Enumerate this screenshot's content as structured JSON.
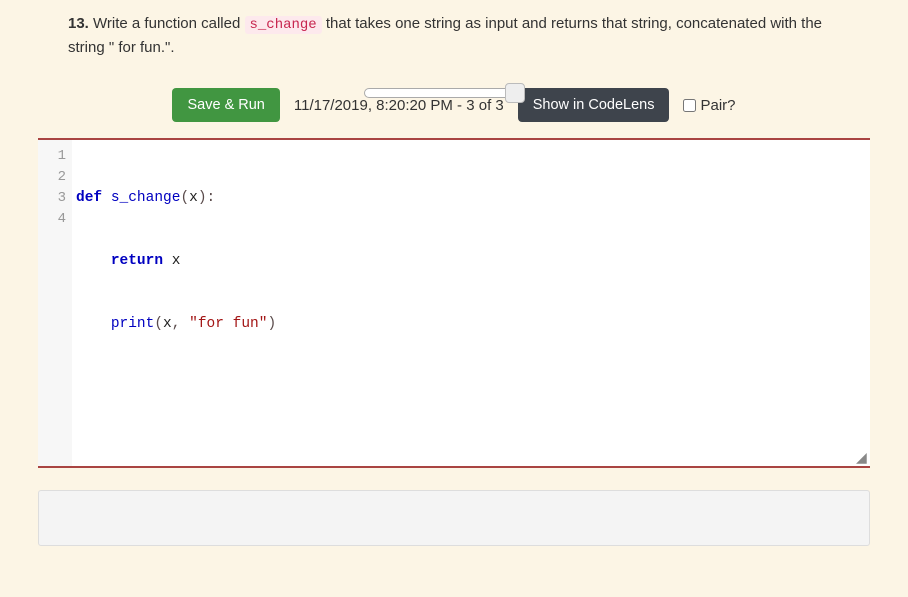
{
  "question": {
    "number": "13.",
    "text_before": " Write a function called ",
    "code_name": "s_change",
    "text_after": " that takes one string as input and returns that string, concatenated with the string \" for fun.\"."
  },
  "toolbar": {
    "save_run": "Save & Run",
    "timestamp": "11/17/2019, 8:20:20 PM - 3 of 3",
    "codelens": "Show in CodeLens",
    "pair_label": "Pair?"
  },
  "code": {
    "line_numbers": [
      "1",
      "2",
      "3",
      "4"
    ],
    "l1": {
      "def": "def",
      "name": "s_change",
      "open": "(",
      "arg": "x",
      "close": "):"
    },
    "l2": {
      "indent": "    ",
      "ret": "return",
      "sp": " ",
      "arg": "x"
    },
    "l3": {
      "indent": "    ",
      "fn": "print",
      "open": "(",
      "arg": "x",
      "comma": ", ",
      "str": "\"for fun\"",
      "close": ")"
    },
    "l4": ""
  }
}
